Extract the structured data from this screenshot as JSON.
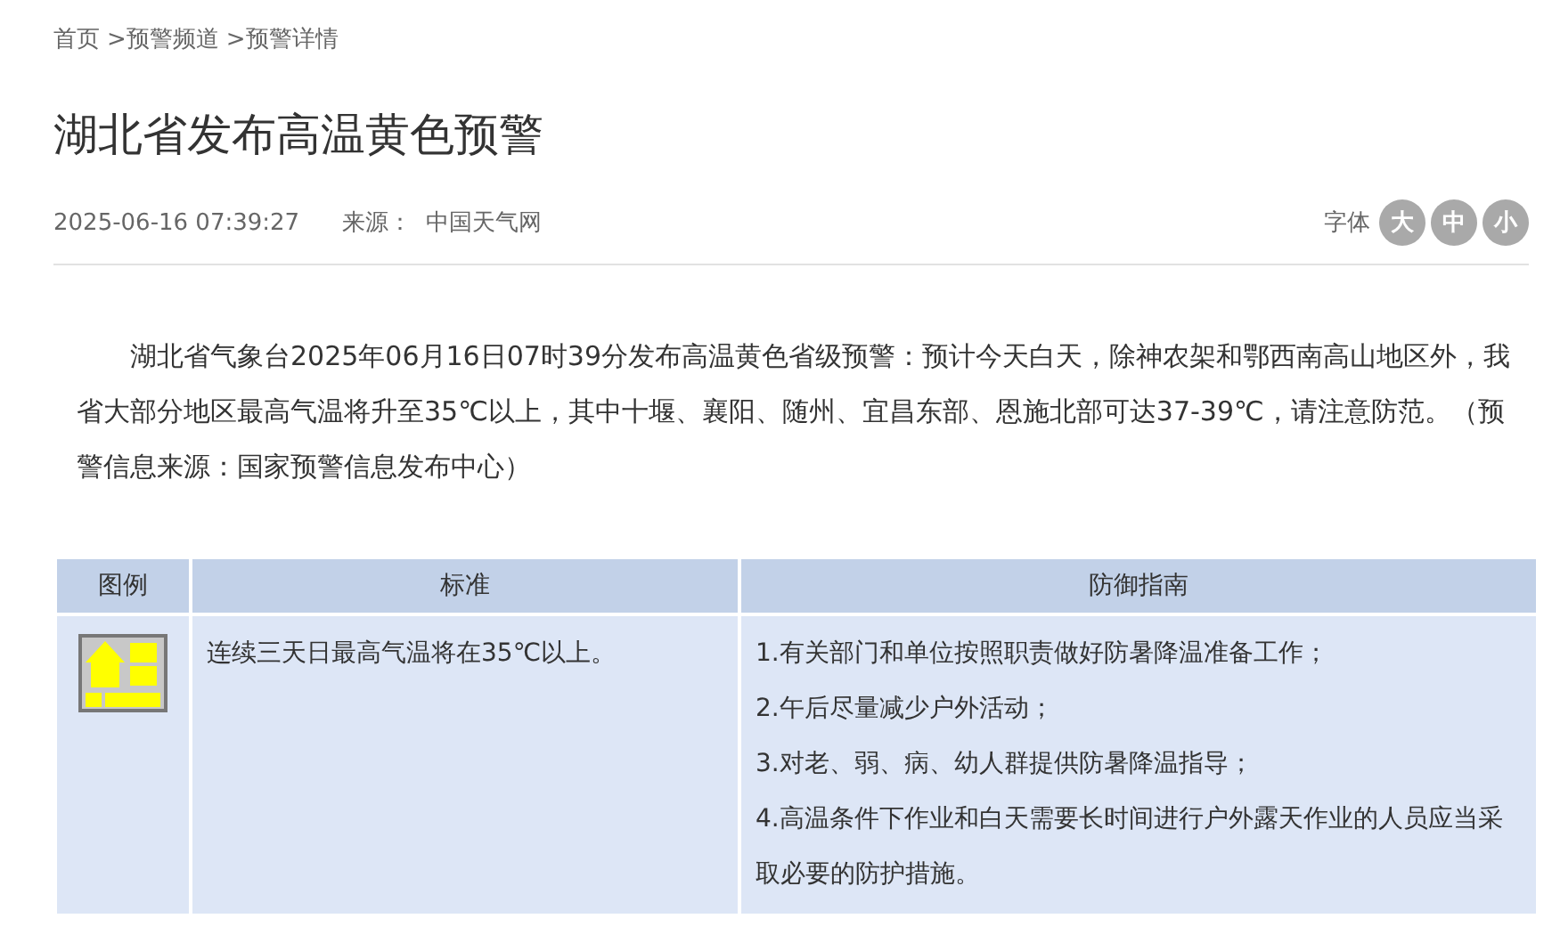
{
  "breadcrumb": [
    {
      "label": "首页"
    },
    {
      "label": "预警频道",
      "separator": ">"
    },
    {
      "label": "预警详情",
      "separator": ">"
    }
  ],
  "title": "湖北省发布高温黄色预警",
  "meta": {
    "time": "2025-06-16 07:39:27",
    "source_label": "来源：",
    "source": "中国天气网",
    "font_label": "字体",
    "font_sizes": [
      "大",
      "中",
      "小"
    ]
  },
  "body": "湖北省气象台2025年06月16日07时39分发布高温黄色省级预警：预计今天白天，除神农架和鄂西南高山地区外，我省大部分地区最高气温将升至35℃以上，其中十堰、襄阳、随州、宜昌东部、恩施北部可达37-39℃，请注意防范。（预警信息来源：国家预警信息发布中心）",
  "table": {
    "columns": [
      "图例",
      "标准",
      "防御指南"
    ],
    "rows": [
      {
        "color": "#ffff00",
        "standard": "连续三天日最高气温将在35℃以上。",
        "guide": [
          "1.有关部门和单位按照职责做好防暑降温准备工作；",
          "2.午后尽量减少户外活动；",
          "3.对老、弱、病、幼人群提供防暑降温指导；",
          "4.高温条件下作业和白天需要长时间进行户外露天作业的人员应当采取必要的防护措施。"
        ]
      }
    ]
  }
}
